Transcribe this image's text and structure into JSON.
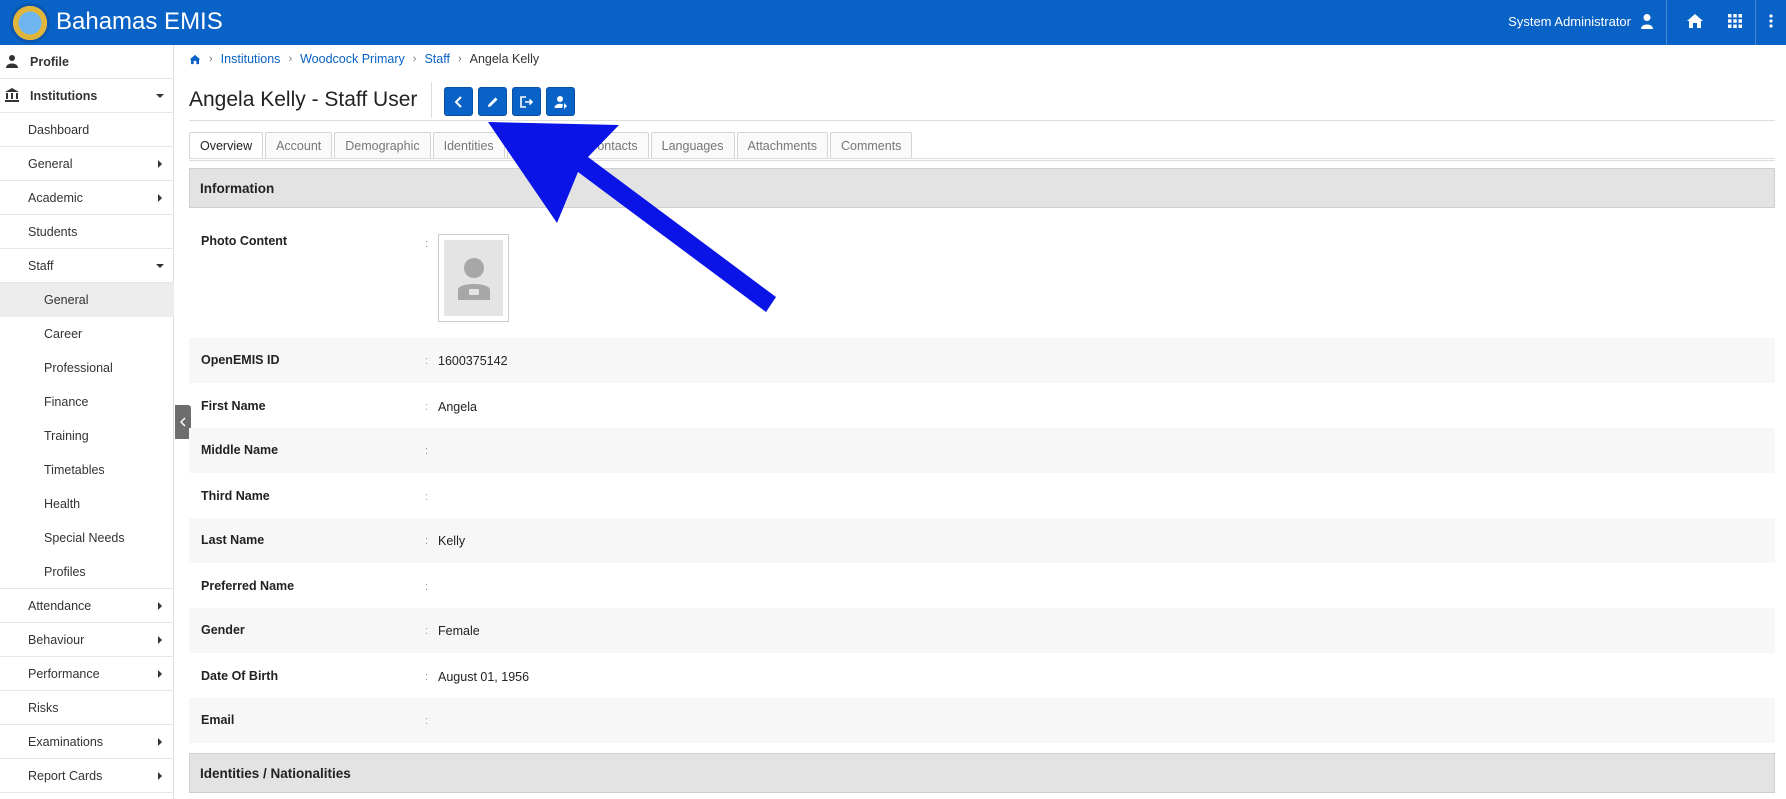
{
  "header": {
    "app_title": "Bahamas EMIS",
    "user_name": "System Administrator",
    "brand_color": "#0962c5",
    "icons": [
      "user-icon",
      "home-icon",
      "apps-grid-icon",
      "more-vertical-icon"
    ]
  },
  "sidebar": {
    "profile": "Profile",
    "institutions": "Institutions",
    "items": [
      {
        "label": "Dashboard"
      },
      {
        "label": "General"
      },
      {
        "label": "Academic"
      },
      {
        "label": "Students"
      },
      {
        "label": "Staff"
      },
      {
        "label": "General"
      },
      {
        "label": "Career"
      },
      {
        "label": "Professional"
      },
      {
        "label": "Finance"
      },
      {
        "label": "Training"
      },
      {
        "label": "Timetables"
      },
      {
        "label": "Health"
      },
      {
        "label": "Special Needs"
      },
      {
        "label": "Profiles"
      },
      {
        "label": "Attendance"
      },
      {
        "label": "Behaviour"
      },
      {
        "label": "Performance"
      },
      {
        "label": "Risks"
      },
      {
        "label": "Examinations"
      },
      {
        "label": "Report Cards"
      }
    ]
  },
  "breadcrumb": {
    "items": [
      "Institutions",
      "Woodcock Primary",
      "Staff"
    ],
    "current": "Angela Kelly"
  },
  "page": {
    "title": "Angela Kelly - Staff User",
    "toolbar_icons": [
      "back-icon",
      "edit-icon",
      "export-icon",
      "user-switch-icon"
    ]
  },
  "tabs": [
    "Overview",
    "Account",
    "Demographic",
    "Identities",
    "Nationalities",
    "Contacts",
    "Languages",
    "Attachments",
    "Comments"
  ],
  "tabs_visible": [
    "Overview",
    "Account",
    "Demographic",
    "Identities",
    "N",
    "ontacts",
    "Languages",
    "Attachments",
    "Comments"
  ],
  "sections": {
    "information": "Information",
    "identities": "Identities / Nationalities"
  },
  "fields": {
    "photo": {
      "label": "Photo Content",
      "colon": ":"
    },
    "openemis_id": {
      "label": "OpenEMIS ID",
      "value": "1600375142"
    },
    "first_name": {
      "label": "First Name",
      "value": "Angela"
    },
    "middle_name": {
      "label": "Middle Name",
      "value": ""
    },
    "third_name": {
      "label": "Third Name",
      "value": ""
    },
    "last_name": {
      "label": "Last Name",
      "value": "Kelly"
    },
    "preferred_name": {
      "label": "Preferred Name",
      "value": ""
    },
    "gender": {
      "label": "Gender",
      "value": "Female"
    },
    "date_of_birth": {
      "label": "Date Of Birth",
      "value": "August 01, 1956"
    },
    "email": {
      "label": "Email",
      "value": ""
    }
  },
  "annotation": {
    "color": "#0a14e6"
  }
}
